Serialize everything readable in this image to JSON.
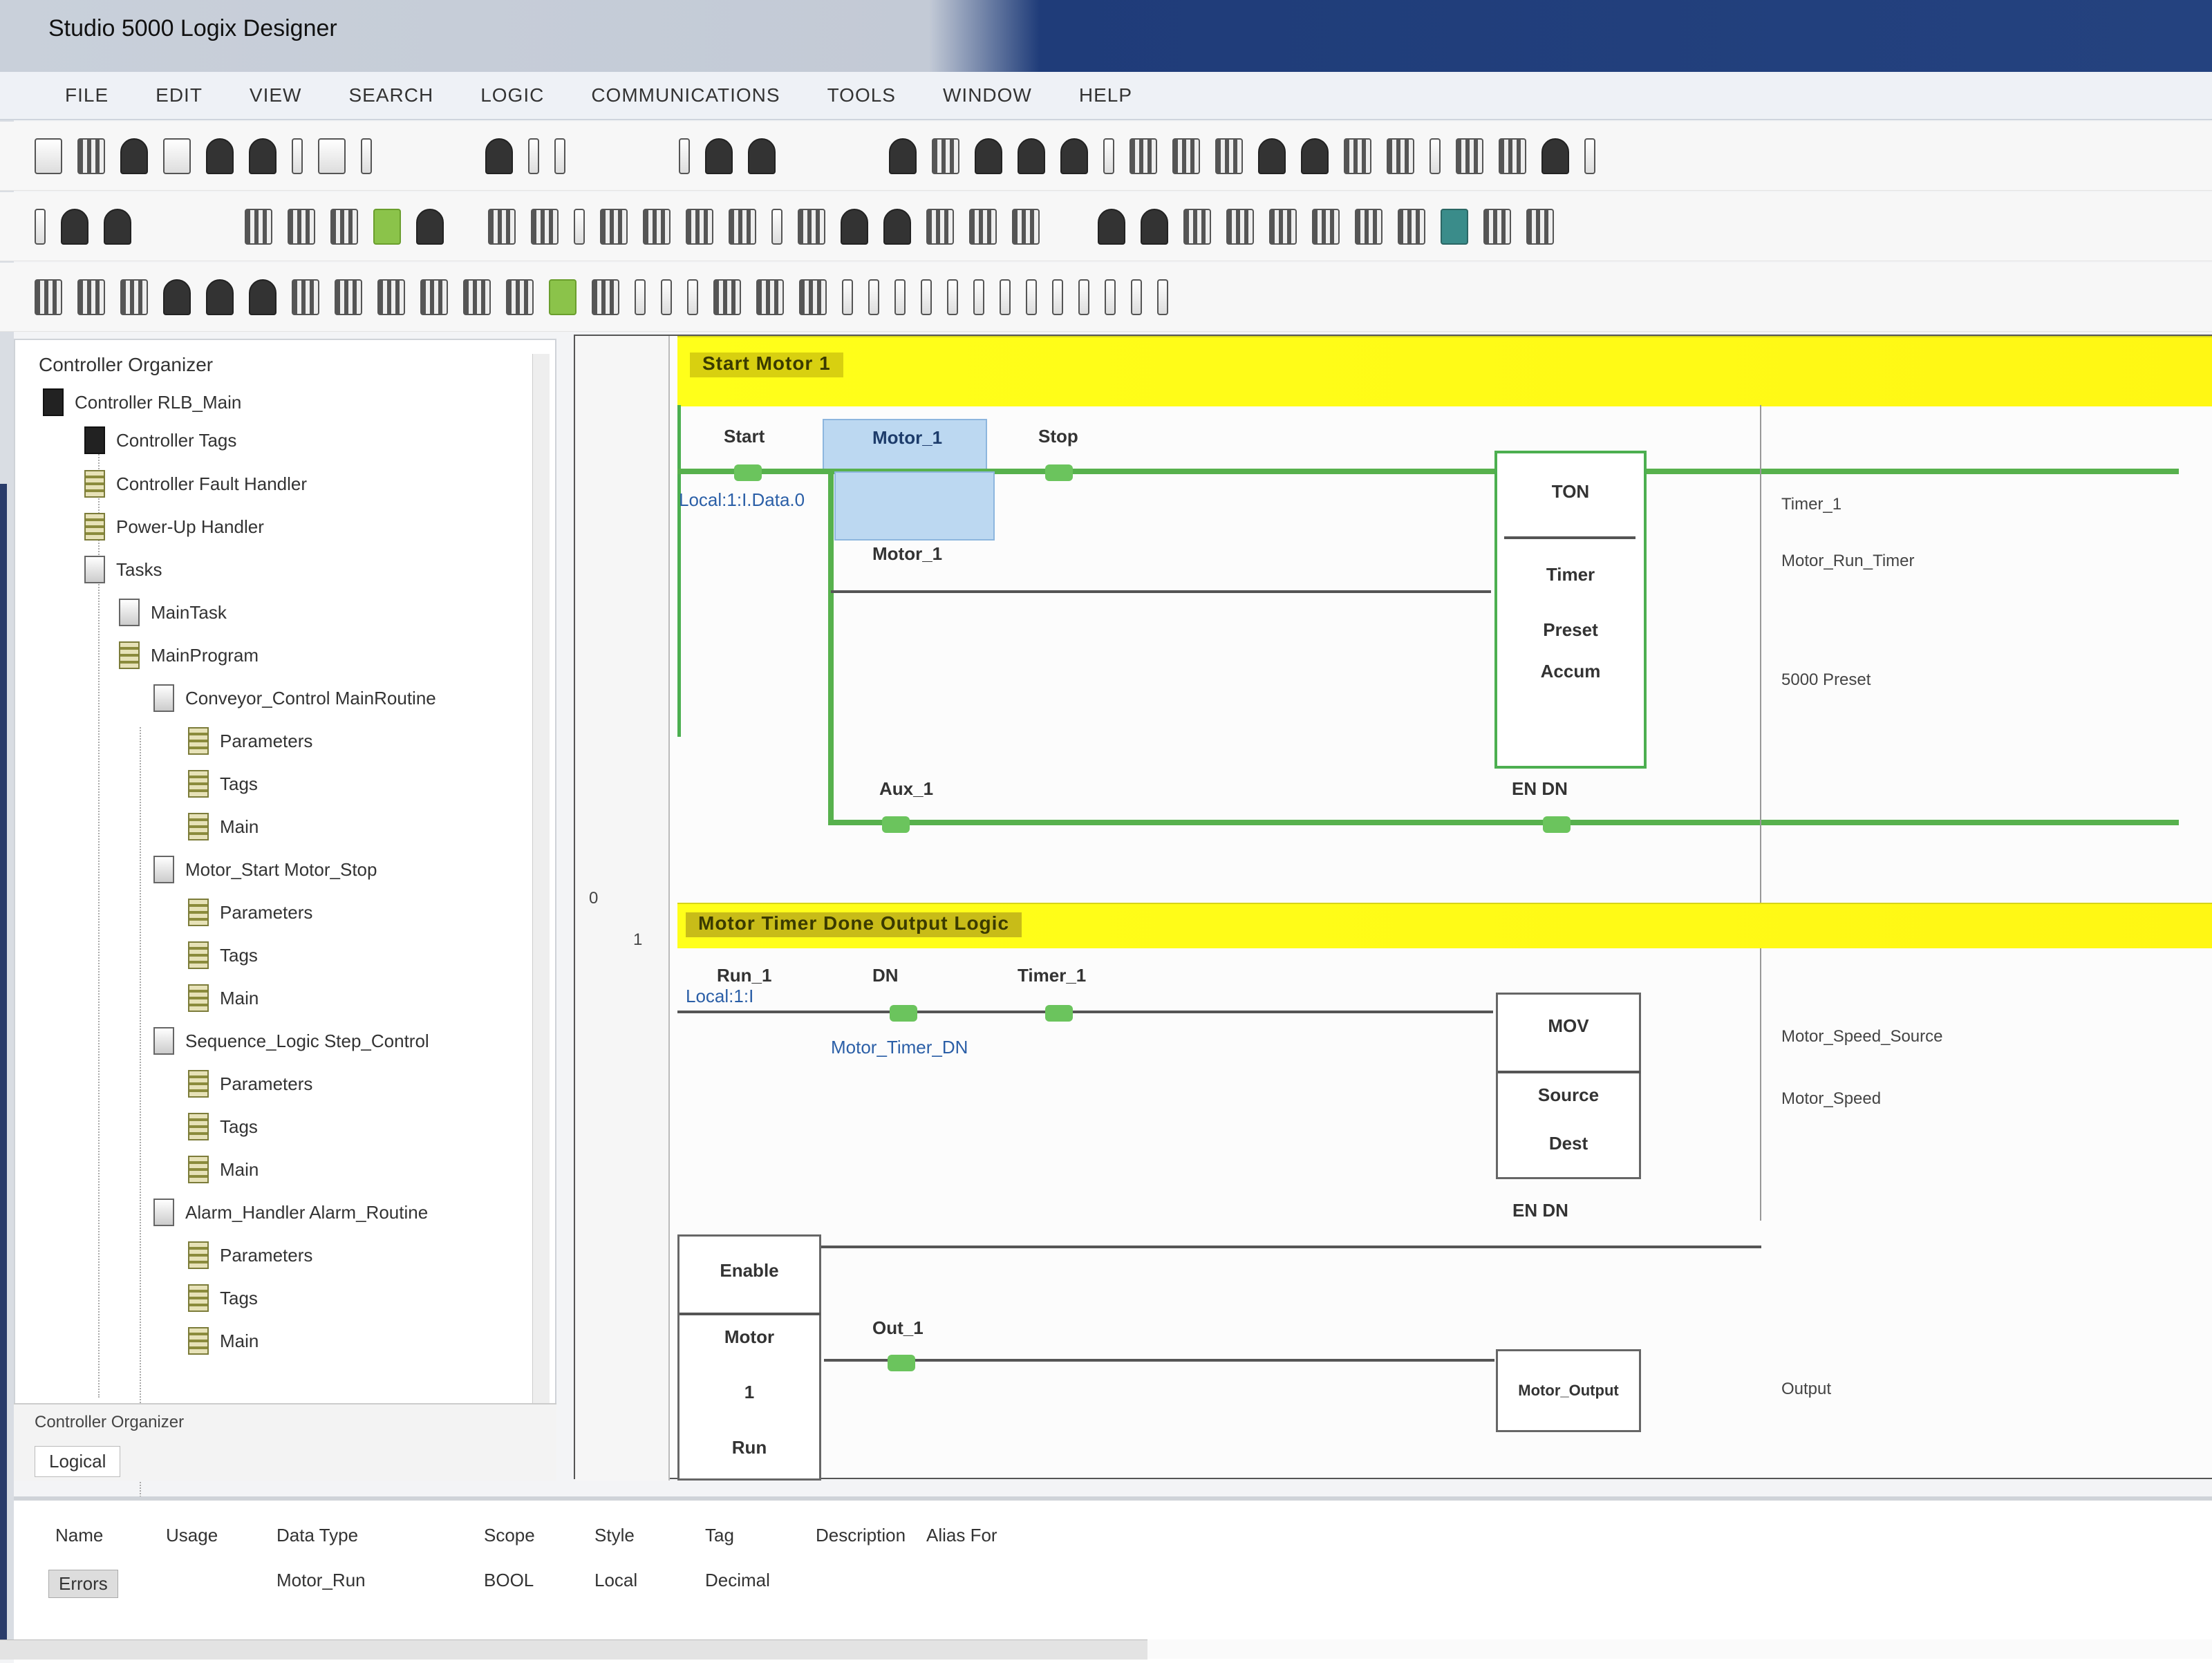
{
  "window": {
    "title": "Studio 5000 Logix Designer"
  },
  "menu": [
    "FILE",
    "EDIT",
    "VIEW",
    "SEARCH",
    "LOGIC",
    "COMMUNICATIONS",
    "TOOLS",
    "WINDOW",
    "HELP"
  ],
  "tree": {
    "title": "Controller Organizer",
    "rows": [
      {
        "label": "Controller RLB_Main",
        "icon": "controller-icon",
        "indent": 0
      },
      {
        "label": "Controller Tags",
        "icon": "tags-icon",
        "indent": 1
      },
      {
        "label": "Controller Fault Handler",
        "icon": "fault-handler-icon",
        "indent": 1
      },
      {
        "label": "Power-Up Handler",
        "icon": "powerup-icon",
        "indent": 1
      },
      {
        "label": "Tasks",
        "icon": "folder-icon",
        "indent": 1
      },
      {
        "label": "MainTask",
        "icon": "task-icon",
        "indent": 2
      },
      {
        "label": "MainProgram",
        "icon": "program-icon",
        "indent": 2
      },
      {
        "label": "Conveyor_Control  MainRoutine",
        "icon": "program-icon",
        "indent": 3
      },
      {
        "label": "Parameters",
        "icon": "routine-icon",
        "indent": 4
      },
      {
        "label": "Tags",
        "icon": "routine-icon",
        "indent": 4
      },
      {
        "label": "Main",
        "icon": "routine-icon",
        "indent": 4
      },
      {
        "label": "Motor_Start  Motor_Stop",
        "icon": "program-icon",
        "indent": 3
      },
      {
        "label": "Parameters",
        "icon": "routine-icon",
        "indent": 4
      },
      {
        "label": "Tags",
        "icon": "routine-icon",
        "indent": 4
      },
      {
        "label": "Main",
        "icon": "routine-icon",
        "indent": 4
      },
      {
        "label": "Sequence_Logic  Step_Control",
        "icon": "program-icon",
        "indent": 3
      },
      {
        "label": "Parameters",
        "icon": "routine-icon",
        "indent": 4
      },
      {
        "label": "Tags",
        "icon": "routine-icon",
        "indent": 4
      },
      {
        "label": "Main",
        "icon": "routine-icon",
        "indent": 4
      },
      {
        "label": "Alarm_Handler  Alarm_Routine",
        "icon": "program-icon",
        "indent": 3
      },
      {
        "label": "Parameters",
        "icon": "routine-icon",
        "indent": 4
      },
      {
        "label": "Tags",
        "icon": "routine-icon",
        "indent": 4
      },
      {
        "label": "Main",
        "icon": "routine-icon",
        "indent": 4
      }
    ],
    "footer_label": "Controller Organizer",
    "footer_tab": "Logical"
  },
  "editor": {
    "rung1": {
      "number": "0",
      "comment": "Start Motor 1",
      "contacts": [
        "Start",
        "Motor_1",
        "Stop"
      ],
      "branch_contact": "Motor_1",
      "input_tag": "Local:1:I.Data.0",
      "bottom_contact": "Aux_1",
      "box_title": "TON",
      "box_lines": [
        "Timer",
        "Preset",
        "Accum"
      ],
      "box_out": "EN  DN",
      "right_labels": [
        "Timer_1",
        "Motor_Run_Timer",
        "5000  Preset"
      ]
    },
    "rung2": {
      "number": "1",
      "comment": "Motor Timer Done Output Logic",
      "contacts": [
        "Run_1",
        "DN",
        "Timer_1"
      ],
      "input_tag": "Local:1:I",
      "tag_desc": "Motor_Timer_DN",
      "box_title": "MOV",
      "box_lines": [
        "Source",
        "Dest"
      ],
      "box_out": "EN  DN",
      "right_labels": [
        "Motor_Speed_Source",
        "Motor_Speed"
      ],
      "branch_box_title": "Enable",
      "branch_box_lines": [
        "Motor",
        "1",
        "Run"
      ],
      "branch_contact": "Out_1",
      "out_box": "Motor_Output",
      "out_label": "Output"
    }
  },
  "bottom": {
    "row1": [
      "Name",
      "Usage",
      "Data Type",
      "Scope",
      "Style",
      "Tag",
      "Description",
      "Alias For"
    ],
    "row2": [
      "Motor_Run",
      "BOOL",
      "Local",
      "Decimal"
    ],
    "tab": "Errors"
  }
}
